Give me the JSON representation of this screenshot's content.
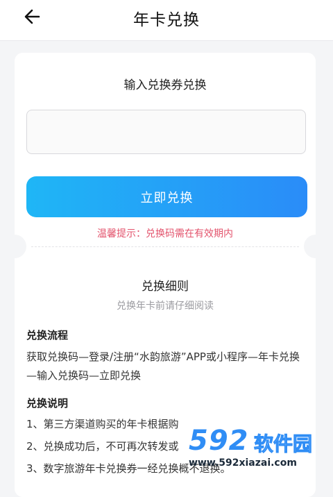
{
  "header": {
    "title": "年卡兑换"
  },
  "redeem": {
    "section_title": "输入兑换券兑换",
    "code_value": "",
    "button_label": "立即兑换",
    "tip": "温馨提示：兑换码需在有效期内"
  },
  "rules": {
    "title": "兑换细则",
    "subtitle": "兑换年卡前请仔细阅读",
    "process_heading": "兑换流程",
    "process_text": "获取兑换码—登录/注册“水韵旅游”APP或小程序—年卡兑换—输入兑换码—立即兑换",
    "notes_heading": "兑换说明",
    "notes": [
      "1、第三方渠道购买的年卡根据购",
      "2、兑换成功后，不可再次转发或",
      "3、数字旅游年卡兑换券一经兑换概不退换。"
    ]
  },
  "watermark": {
    "number": "592",
    "text": "软件园",
    "url": "www.592xiazai.com"
  },
  "colors": {
    "accent": "#2a8cf8",
    "tip": "#e3536c"
  }
}
